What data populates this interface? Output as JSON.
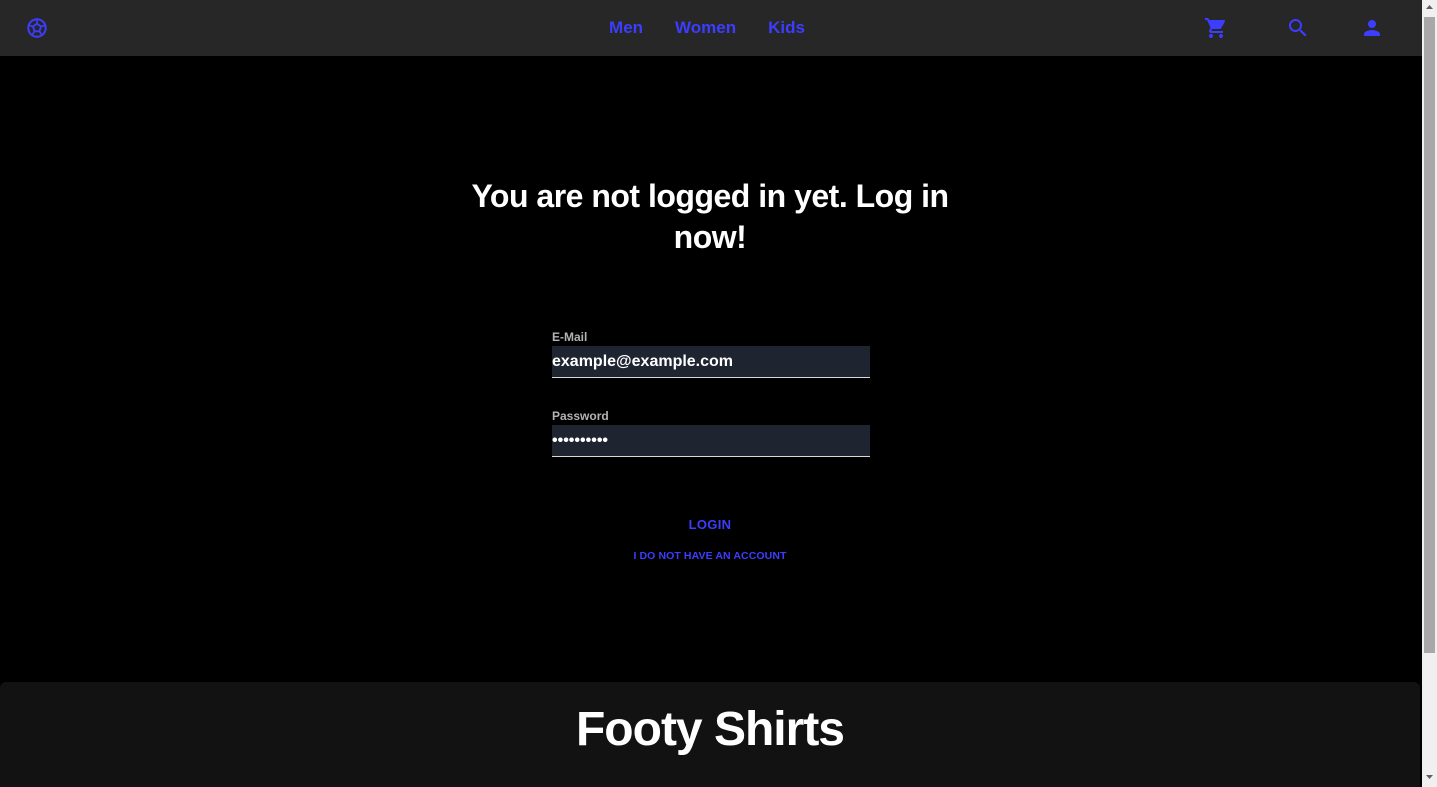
{
  "colors": {
    "accent": "#3d3dff",
    "navbar_bg": "#272727",
    "page_bg": "#000000",
    "input_bg": "#1e2530",
    "footer_bg": "#121212",
    "text": "#ffffff",
    "label": "#b3b3b3"
  },
  "navbar": {
    "brand_icon": "soccer-ball-icon",
    "links": [
      "Men",
      "Women",
      "Kids"
    ],
    "actions": [
      "cart-icon",
      "search-icon",
      "account-icon"
    ]
  },
  "login": {
    "heading": "You are not logged in yet. Log in now!",
    "email_label": "E-Mail",
    "email_value": "example@example.com",
    "password_label": "Password",
    "password_value": "••••••••••",
    "login_button": "LOGIN",
    "register_link": "I DO NOT HAVE AN ACCOUNT"
  },
  "footer": {
    "title": "Footy Shirts"
  }
}
